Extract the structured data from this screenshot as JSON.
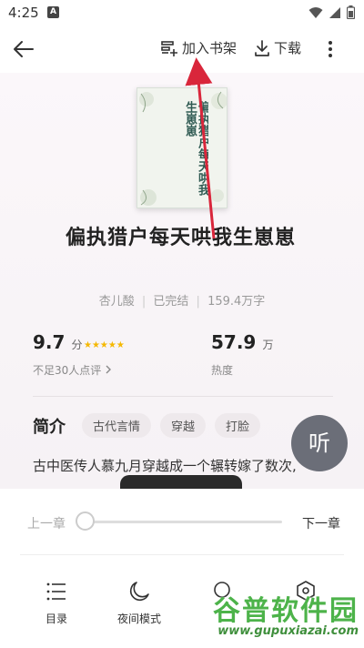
{
  "status_bar": {
    "time": "4:25",
    "app_badge": "A"
  },
  "top_bar": {
    "add_to_shelf": "加入书架",
    "download": "下载"
  },
  "book": {
    "cover_title": "偏执猎户每天哄我生崽崽",
    "title": "偏执猎户每天哄我生崽崽",
    "author": "杏儿酸",
    "status": "已完结",
    "word_count": "159.4万字",
    "meta_separator": "|"
  },
  "stats": {
    "rating_value": "9.7",
    "rating_unit": "分",
    "stars": 5,
    "rating_sub": "不足30人点评",
    "heat_value": "57.9",
    "heat_unit": "万",
    "heat_label": "热度"
  },
  "intro": {
    "heading": "简介",
    "tags": [
      "古代言情",
      "穿越",
      "打脸"
    ],
    "text": "古中医传人慕九月穿越成一个辗转嫁了数次,"
  },
  "listen_button": "听",
  "reader_panel": {
    "prev_chapter": "上一章",
    "next_chapter": "下一章",
    "progress": 0
  },
  "menu": [
    {
      "label": "目录",
      "icon": "list-icon"
    },
    {
      "label": "夜间模式",
      "icon": "moon-icon"
    },
    {
      "label": "",
      "icon": "settings-icon"
    },
    {
      "label": "",
      "icon": "settings-icon"
    }
  ],
  "watermark": {
    "title": "谷普软件园",
    "url": "www.gupuxiazai.com"
  },
  "colors": {
    "accent_star": "#f5b800",
    "arrow": "#d9263b",
    "listen_bg": "#6b6e78"
  }
}
